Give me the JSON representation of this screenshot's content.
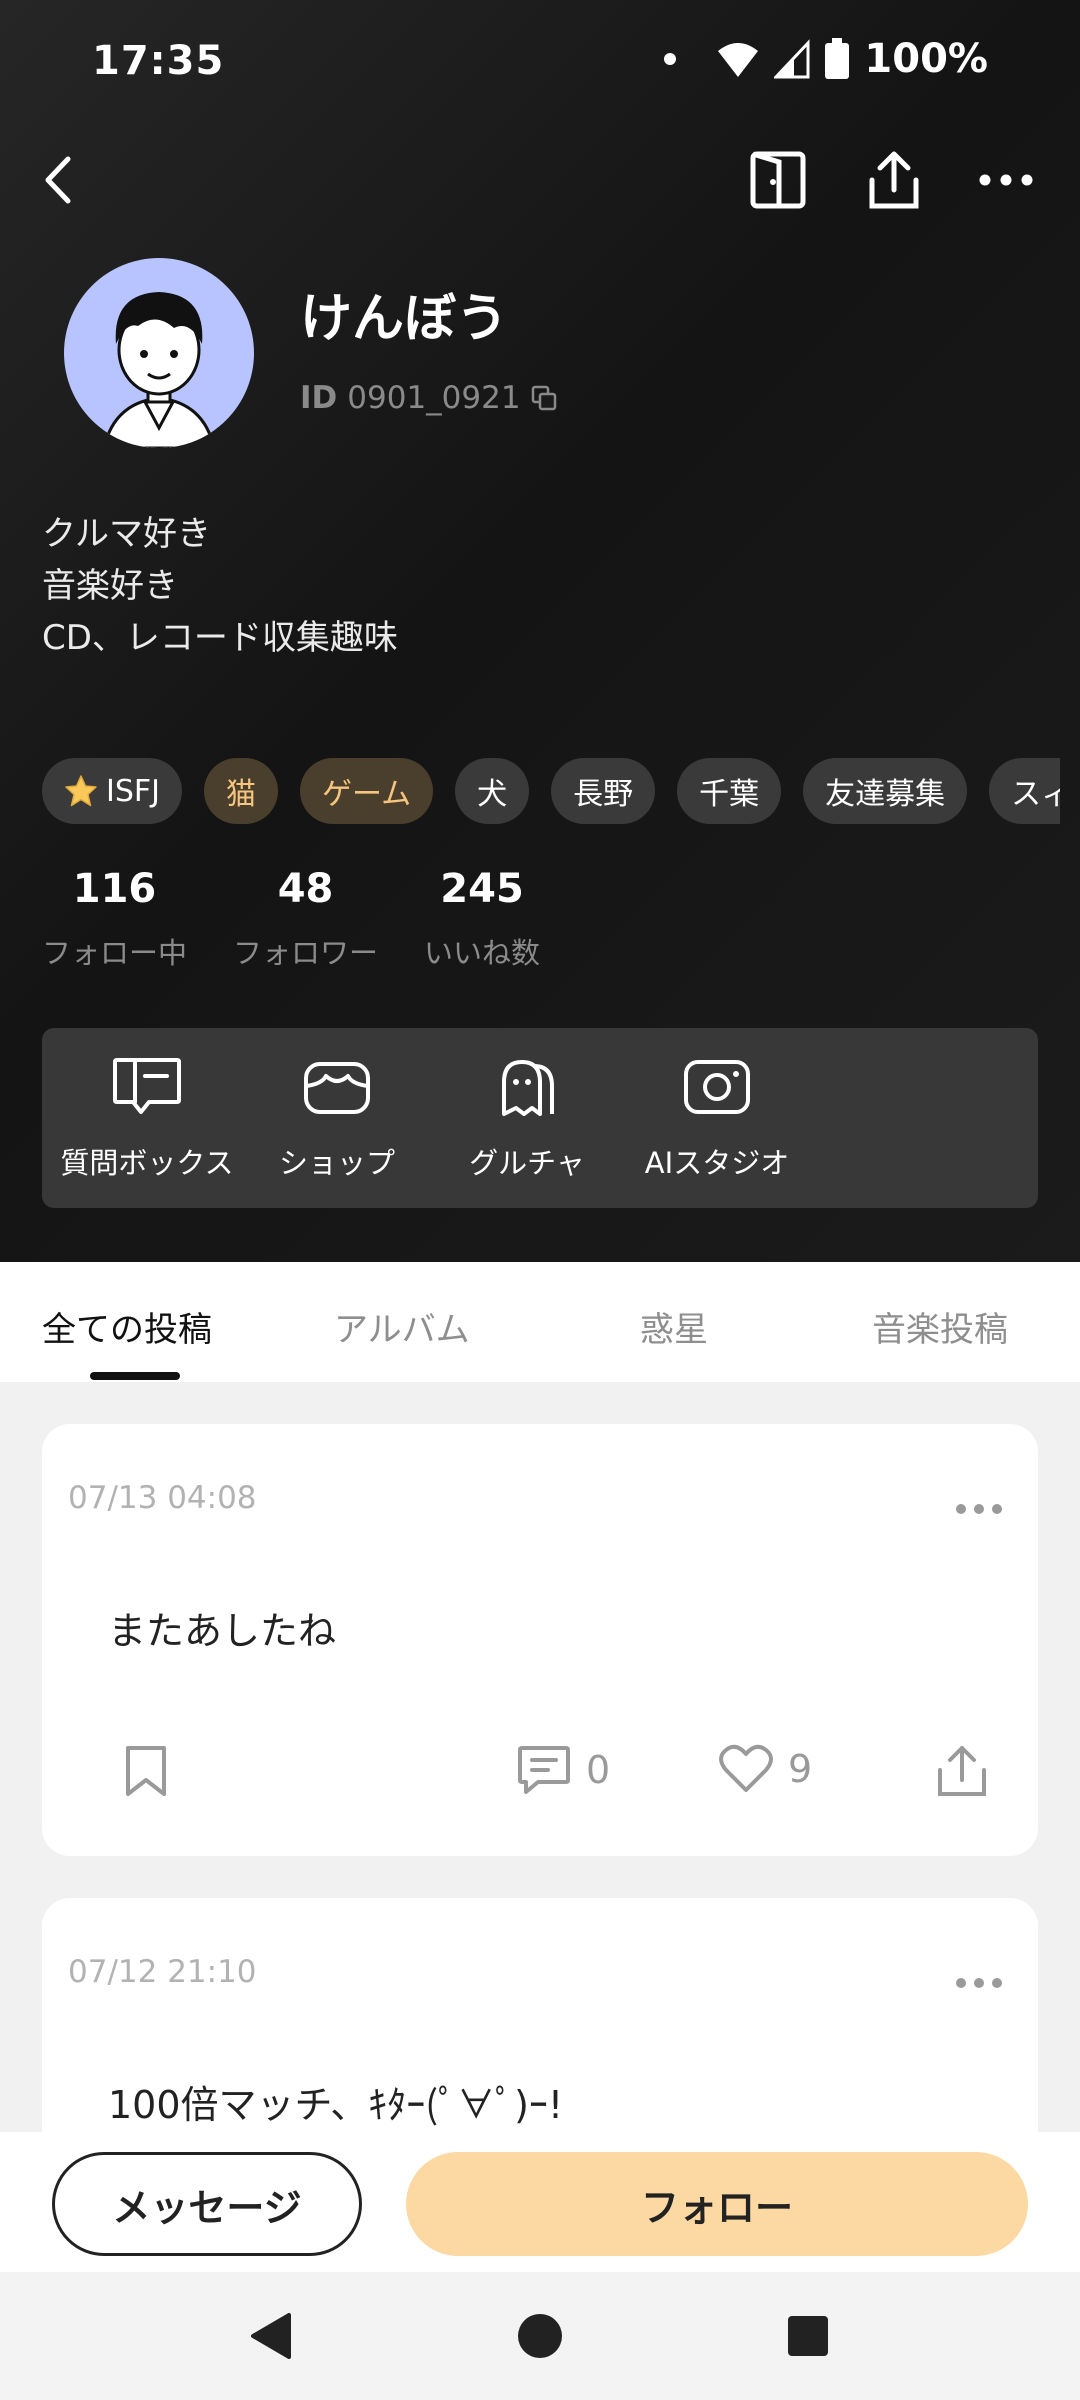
{
  "status": {
    "time": "17:35",
    "battery": "100%"
  },
  "profile": {
    "name": "けんぼう",
    "id_label": "ID",
    "id_value": "0901_0921",
    "bio": [
      "クルマ好き",
      "音楽好き",
      "CD、レコード収集趣味"
    ]
  },
  "tags": [
    {
      "label": "ISFJ",
      "icon": "star-icon",
      "highlight": false
    },
    {
      "label": "猫",
      "highlight": true
    },
    {
      "label": "ゲーム",
      "highlight": true
    },
    {
      "label": "犬",
      "highlight": false
    },
    {
      "label": "長野",
      "highlight": false
    },
    {
      "label": "千葉",
      "highlight": false
    },
    {
      "label": "友達募集",
      "highlight": false
    },
    {
      "label": "スィ",
      "highlight": false
    }
  ],
  "stats": [
    {
      "value": "116",
      "label": "フォロー中"
    },
    {
      "value": "48",
      "label": "フォロワー"
    },
    {
      "value": "245",
      "label": "いいね数"
    }
  ],
  "tools": [
    {
      "label": "質問ボックス",
      "icon": "question-box-icon"
    },
    {
      "label": "ショップ",
      "icon": "shop-icon"
    },
    {
      "label": "グルチャ",
      "icon": "group-chat-icon"
    },
    {
      "label": "AIスタジオ",
      "icon": "ai-studio-icon"
    }
  ],
  "tabs": [
    "全ての投稿",
    "アルバム",
    "惑星",
    "音楽投稿"
  ],
  "posts": [
    {
      "time": "07/13 04:08",
      "text": "またあしたね",
      "comments": "0",
      "likes": "9"
    },
    {
      "time": "07/12 21:10",
      "text": "100倍マッチ、ｷﾀｰ(ﾟ∀ﾟ)ｰ!"
    }
  ],
  "actions": {
    "message": "メッセージ",
    "follow": "フォロー"
  },
  "colors": {
    "accent": "#fcd9a3",
    "tag_highlight_text": "#f6c57f",
    "header_bg": "#1a1a1a"
  }
}
